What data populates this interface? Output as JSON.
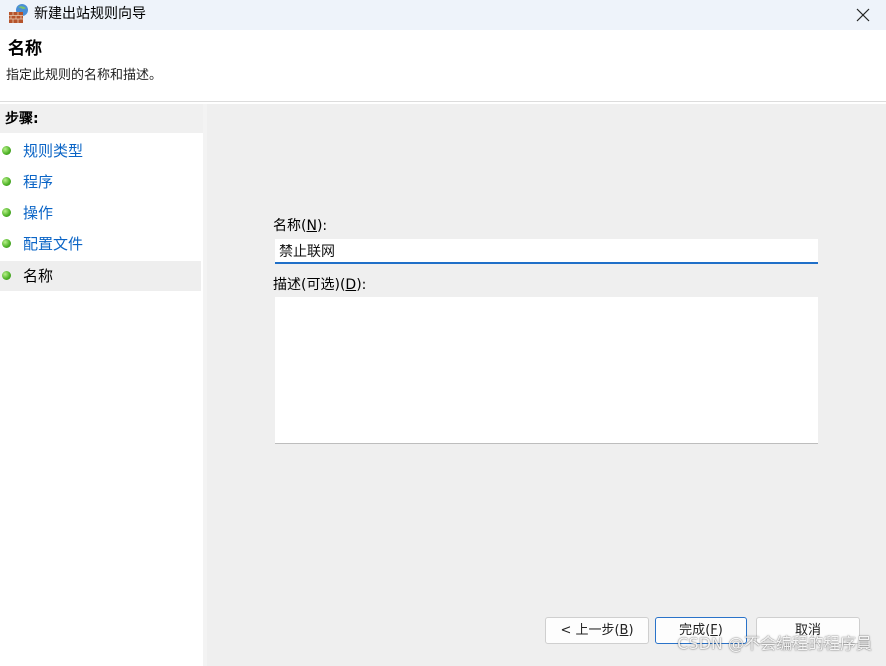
{
  "window": {
    "title": "新建出站规则向导",
    "icon": "firewall-brick-wall-icon"
  },
  "header": {
    "title": "名称",
    "subtitle": "指定此规则的名称和描述。"
  },
  "steps": {
    "heading": "步骤:",
    "items": [
      {
        "label": "规则类型",
        "active": false
      },
      {
        "label": "程序",
        "active": false
      },
      {
        "label": "操作",
        "active": false
      },
      {
        "label": "配置文件",
        "active": false
      },
      {
        "label": "名称",
        "active": true
      }
    ]
  },
  "form": {
    "name_label": "名称",
    "name_hotkey": "(N)",
    "name_hotkey_char": "N",
    "name_label_suffix": ":",
    "name_value": "禁止联网",
    "desc_label": "描述(可选)",
    "desc_hotkey_char": "D",
    "desc_label_suffix": ":",
    "desc_value": ""
  },
  "buttons": {
    "back_label": "< 上一步",
    "back_hotkey_char": "B",
    "finish_label": "完成",
    "finish_hotkey_char": "F",
    "cancel_label": "取消"
  },
  "watermark": "CSDN @不会编程的程序員",
  "colors": {
    "titlebar_bg": "#eef3fa",
    "step_link": "#0a64c6",
    "step_dot": "#52b52a",
    "content_bg": "#efefef",
    "input_focus": "#1f6fc8"
  }
}
